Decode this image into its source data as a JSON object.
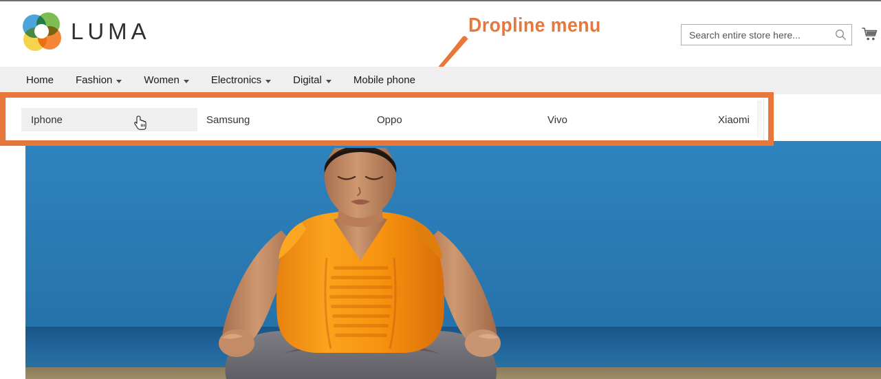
{
  "page": {
    "site_name": "LUMA"
  },
  "header": {
    "logo_text": "LUMA",
    "logo_icon": "luma-flower-logo-icon",
    "logo_colors": {
      "blue": "#3C9CD8",
      "green": "#72B844",
      "orange": "#F07D26",
      "yellow": "#F5CF3E"
    }
  },
  "search": {
    "placeholder": "Search entire store here...",
    "value": "",
    "icon": "search-icon"
  },
  "cart": {
    "icon": "shopping-cart-icon",
    "count": ""
  },
  "annotation": {
    "label": "Dropline menu",
    "color": "#E8773C",
    "arrow_icon": "arrow-down-left-icon",
    "highlight_color": "#E8773C"
  },
  "nav": {
    "items": [
      {
        "label": "Home",
        "has_caret": false
      },
      {
        "label": "Fashion",
        "has_caret": true
      },
      {
        "label": "Women",
        "has_caret": true
      },
      {
        "label": "Electronics",
        "has_caret": true
      },
      {
        "label": "Digital",
        "has_caret": true
      },
      {
        "label": "Mobile phone",
        "has_caret": false
      }
    ]
  },
  "dropline": {
    "parent": "Mobile phone",
    "items": [
      {
        "label": "Iphone",
        "hovered": true
      },
      {
        "label": "Samsung",
        "hovered": false
      },
      {
        "label": "Oppo",
        "hovered": false
      },
      {
        "label": "Vivo",
        "hovered": false
      },
      {
        "label": "Xiaomi",
        "hovered": false
      }
    ],
    "hover_background": "#EFEFEF"
  },
  "cursor": {
    "icon": "pointing-hand-cursor-icon"
  },
  "hero": {
    "alt": "Woman meditating in lotus pose on a beach wearing an orange top",
    "colors": {
      "sky": "#2F83BE",
      "sea": "#1B5486",
      "sand": "#8C7C5A",
      "shirt": "#F79420",
      "pants": "#6E6E72",
      "skin": "#C79070"
    }
  }
}
